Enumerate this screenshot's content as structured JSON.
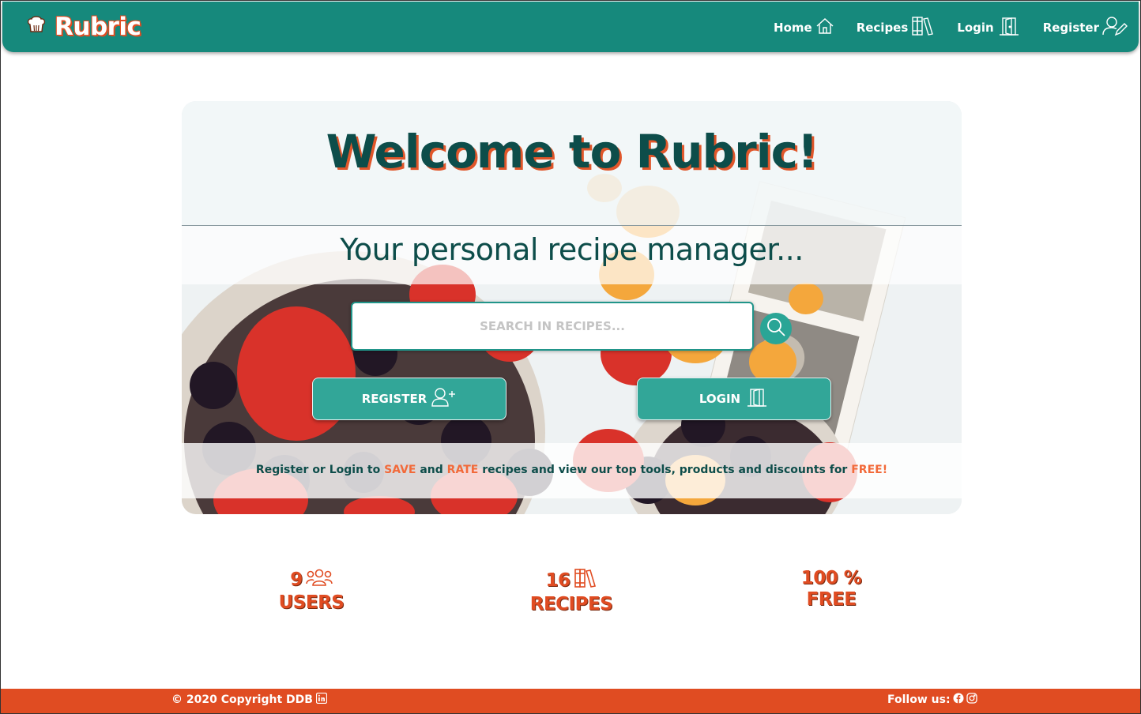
{
  "brand": {
    "name": "Rubric",
    "icon": "chef-hat-icon"
  },
  "nav": [
    {
      "label": "Home",
      "icon": "home-icon"
    },
    {
      "label": "Recipes",
      "icon": "books-icon"
    },
    {
      "label": "Login",
      "icon": "door-icon"
    },
    {
      "label": "Register",
      "icon": "user-edit-icon"
    }
  ],
  "hero": {
    "title": "Welcome to Rubric!",
    "subtitle": "Your personal recipe manager...",
    "search_placeholder": "SEARCH IN RECIPES...",
    "register_label": "REGISTER",
    "login_label": "LOGIN",
    "info": {
      "part1": "Register or Login to ",
      "save": "SAVE",
      "and": " and ",
      "rate": "RATE",
      "part2": " recipes and view our top tools, products and discounts for ",
      "free": "FREE!"
    }
  },
  "stats": [
    {
      "value": "9",
      "label": "USERS",
      "icon": "users-icon"
    },
    {
      "value": "16",
      "label": "RECIPES",
      "icon": "books-icon"
    },
    {
      "value": "100 %",
      "label": "FREE"
    }
  ],
  "footer": {
    "copyright": "© 2020 Copyright DDB",
    "follow": "Follow us:"
  },
  "colors": {
    "primary": "#16897c",
    "accent": "#e04c22",
    "dark_text": "#0d4d4a"
  }
}
